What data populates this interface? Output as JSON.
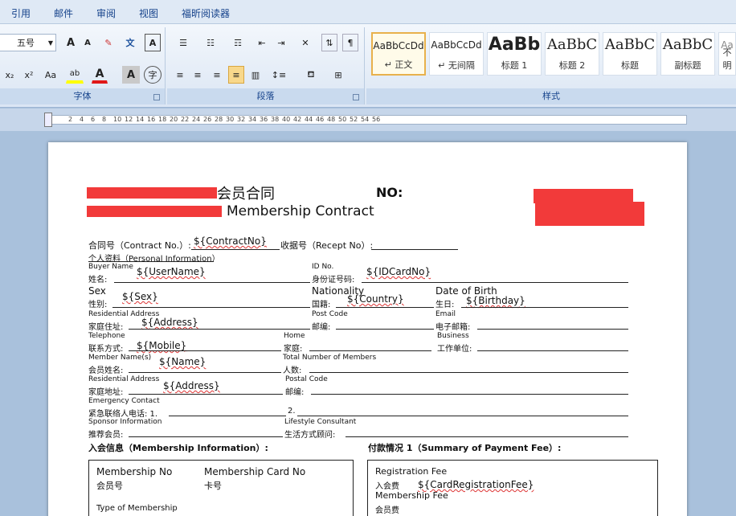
{
  "menu": [
    "引用",
    "邮件",
    "审阅",
    "视图",
    "福昕阅读器"
  ],
  "ribbon": {
    "font": {
      "label": "字体",
      "size": "五号",
      "grow": "A",
      "shrink": "A",
      "clear": "A",
      "phonetic": "文",
      "border_char": "A",
      "subscript": "x₂",
      "superscript": "x²",
      "change_case": "Aa",
      "highlight": "ab",
      "font_color": "A",
      "shading": "A",
      "enclose": "字"
    },
    "paragraph": {
      "label": "段落"
    },
    "styles": {
      "label": "样式",
      "tiles": [
        {
          "preview": "AaBbCcDd",
          "name": "↵ 正文"
        },
        {
          "preview": "AaBbCcDd",
          "name": "↵ 无间隔"
        },
        {
          "preview": "AaBb",
          "name": "标题 1"
        },
        {
          "preview": "AaBbC",
          "name": "标题 2"
        },
        {
          "preview": "AaBbC",
          "name": "标题"
        },
        {
          "preview": "AaBbC",
          "name": "副标题"
        },
        {
          "preview": "Aa",
          "name": "不明"
        }
      ]
    }
  },
  "ruler_ticks": [
    "2",
    "4",
    "6",
    "8",
    "10",
    "12",
    "14",
    "16",
    "18",
    "20",
    "22",
    "24",
    "26",
    "28",
    "30",
    "32",
    "34",
    "36",
    "38",
    "40",
    "42",
    "44",
    "46",
    "48",
    "50",
    "52",
    "54",
    "56"
  ],
  "doc": {
    "title_cn": "会员合同",
    "title_no": "NO:",
    "title_en": "Membership Contract",
    "contract_no_label": "合同号（Contract No.）:",
    "contract_no_value": "${ContractNo}",
    "receipt_label": "收据号（Recept No）:",
    "personal_info": "个人资料（Personal Information）",
    "buyer_en": "Buyer Name",
    "buyer_cn": "姓名:",
    "buyer_value": "${UserName}",
    "id_en": "ID No.",
    "id_cn": "身份证号码:",
    "id_value": "${IDCardNo}",
    "sex_en": "Sex",
    "sex_cn": "性别:",
    "sex_value": "${Sex}",
    "nat_en": "Nationality",
    "nat_cn": "国籍:",
    "nat_value": "${Country}",
    "dob_en": "Date of Birth",
    "dob_cn": "生日:",
    "dob_value": "${Birthday}",
    "res_en": "Residential Address",
    "res_cn": "家庭住址:",
    "res_value": "${Address}",
    "post_en": "Post Code",
    "post_cn": "邮编:",
    "email_en": "Email",
    "email_cn": "电子邮箱:",
    "tel_en": "Telephone",
    "tel_cn": "联系方式:",
    "tel_value": "${Mobile}",
    "home_en": "Home",
    "home_cn": "家庭:",
    "biz_en": "Business",
    "biz_cn": "工作单位:",
    "member_en": "Member Name(s)",
    "member_cn": "会员姓名:",
    "member_value": "${Name}",
    "total_en": "Total Number of Members",
    "total_cn": "人数:",
    "res2_en": "Residential Address",
    "res2_cn": "家庭地址:",
    "res2_value": "${Address}",
    "postal_en": "Postal Code",
    "postal_cn": "邮编:",
    "emerg_en": "Emergency Contact",
    "emerg_cn": "紧急联络人电话: 1.",
    "emerg_2": "2.",
    "sponsor_en": "Sponsor Information",
    "sponsor_cn": "推荐会员:",
    "life_en": "Lifestyle Consultant",
    "life_cn": "生活方式顾问:",
    "membership_info": "入会信息（Membership Information）:",
    "payment_summary": "付款情况 1（Summary of Payment Fee）:",
    "mno_en": "Membership No",
    "mno_cn": "会员号",
    "card_en": "Membership Card No",
    "card_cn": "卡号",
    "type_en": "Type of Membership",
    "reg_en": "Registration Fee",
    "reg_cn": "入会费",
    "reg_value": "${CardRegistrationFee}",
    "mfee_en": "Membership Fee",
    "mfee_cn": "会员费"
  },
  "colors": {
    "redaction": "#f23a3a",
    "ribbon_text": "#15428b"
  }
}
